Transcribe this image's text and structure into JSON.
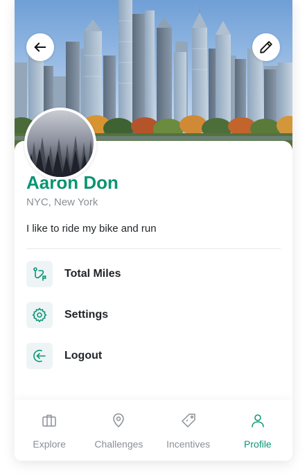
{
  "profile": {
    "name": "Aaron Don",
    "location": "NYC, New York",
    "bio": "I like to ride my bike and run"
  },
  "menu": [
    {
      "label": "Total Miles",
      "icon": "route-icon"
    },
    {
      "label": "Settings",
      "icon": "gear-icon"
    },
    {
      "label": "Logout",
      "icon": "logout-icon"
    }
  ],
  "nav": [
    {
      "label": "Explore",
      "icon": "briefcase-icon",
      "active": false
    },
    {
      "label": "Challenges",
      "icon": "map-pin-icon",
      "active": false
    },
    {
      "label": "Incentives",
      "icon": "tag-icon",
      "active": false
    },
    {
      "label": "Profile",
      "icon": "user-icon",
      "active": true
    }
  ],
  "colors": {
    "accent": "#0a9573",
    "muted": "#8a8f95",
    "icon_bg": "#eef4f6"
  }
}
